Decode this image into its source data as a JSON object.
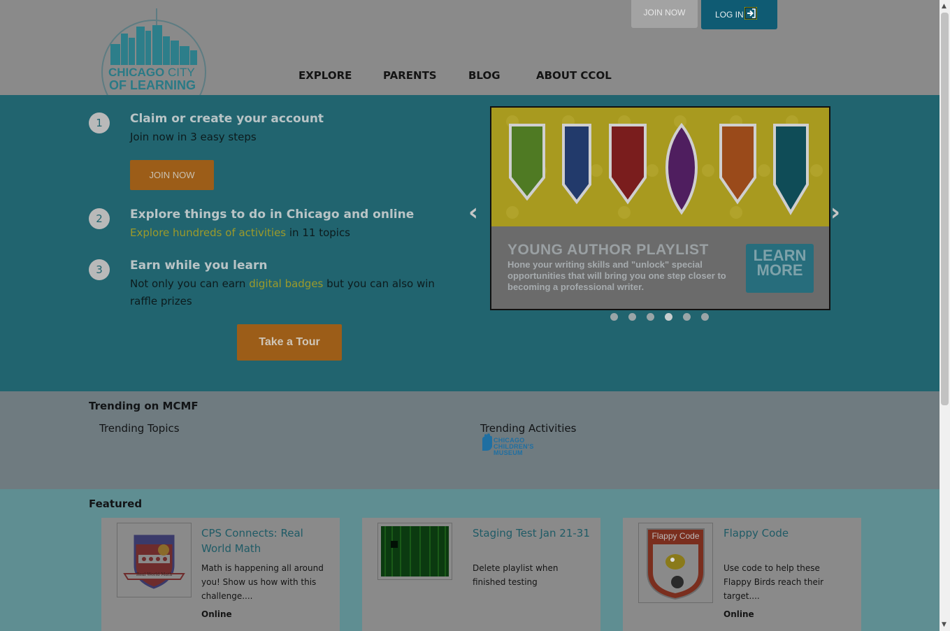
{
  "header": {
    "logo_text_1": "CHICAGO",
    "logo_text_2": "CITY",
    "logo_text_3": "OF LEARNING",
    "join_now": "JOIN NOW",
    "log_in": "LOG IN",
    "nav": [
      "EXPLORE",
      "PARENTS",
      "BLOG",
      "ABOUT CCOL"
    ]
  },
  "hero": {
    "steps": [
      {
        "num": "1",
        "title": "Claim or create your account",
        "desc": "Join now in 3 easy steps"
      },
      {
        "num": "2",
        "title": "Explore things to do in Chicago and online",
        "link": "Explore hundreds of activities",
        "desc_tail": " in 11 topics"
      },
      {
        "num": "3",
        "title": "Earn while you learn",
        "desc_head": "Not only you can earn ",
        "link": "digital badges",
        "desc_tail": " but you can also win raffle prizes"
      }
    ],
    "join_button": "JOIN NOW",
    "tour_button": "Take a Tour",
    "slide": {
      "title": "YOUNG AUTHOR PLAYLIST",
      "body": "Hone your writing skills and \"unlock\" special opportunities that will bring you one step closer to becoming a professional writer.",
      "cta": "LEARN MORE"
    },
    "carousel_active_dot": 4,
    "carousel_dot_count": 6
  },
  "trending": {
    "title": "Trending on MCMF",
    "topics_label": "Trending Topics",
    "activities_label": "Trending Activities",
    "museum_logo": "CHICAGO CHILDREN'S MUSEUM"
  },
  "featured": {
    "title": "Featured",
    "cards": [
      {
        "title": "CPS Connects: Real World Math",
        "desc": "Math is happening all around you! Show us how with this challenge....",
        "location": "Online",
        "badge_text": "Real World Math"
      },
      {
        "title": "Staging Test Jan 21-31",
        "desc": "Delete playlist when finished testing",
        "location": ""
      },
      {
        "title": "Flappy Code",
        "desc": "Use code to help these Flappy Birds reach their target....",
        "location": "Online",
        "badge_text": "Flappy Code"
      }
    ]
  },
  "colors": {
    "hero_bg": "#21646f",
    "accent_orange": "#9c5d18",
    "login_blue": "#0f5b73",
    "link_yellow": "#9c9a2a"
  }
}
